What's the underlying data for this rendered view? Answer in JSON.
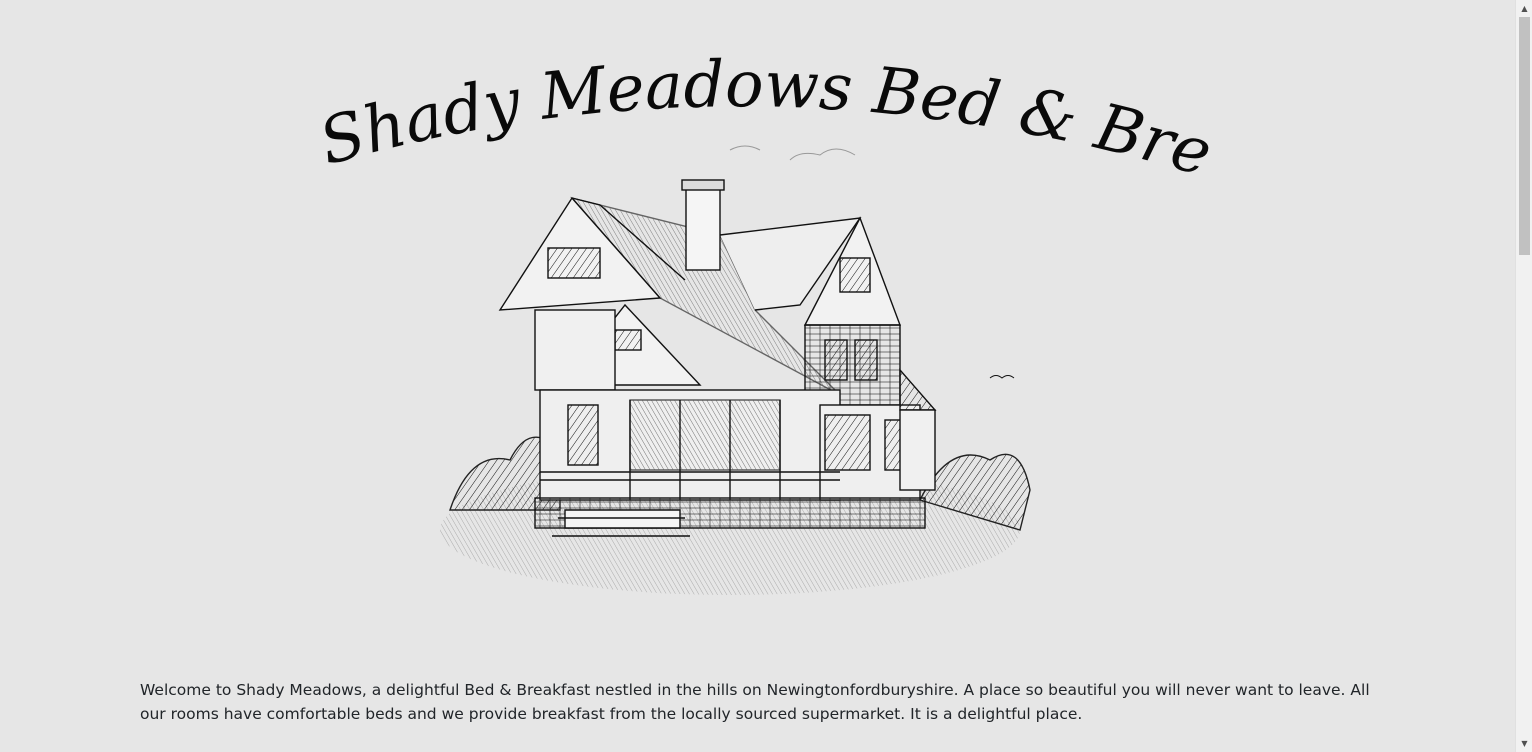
{
  "site": {
    "logo_title": "Shady Meadows Bed & Breakfast",
    "illustration_icon": "house-sketch-illustration"
  },
  "welcome": {
    "text": "Welcome to Shady Meadows, a delightful Bed & Breakfast nestled in the hills on Newingtonfordburyshire. A place so beautiful you will never want to leave. All our rooms have comfortable beds and we provide breakfast from the locally sourced supermarket. It is a delightful place."
  },
  "scrollbar": {
    "up_icon": "scroll-up-arrow-icon",
    "down_icon": "scroll-down-arrow-icon",
    "position": 0.0
  },
  "colors": {
    "background": "#e6e6e6",
    "ink": "#0a0a0a",
    "text": "#212529"
  }
}
